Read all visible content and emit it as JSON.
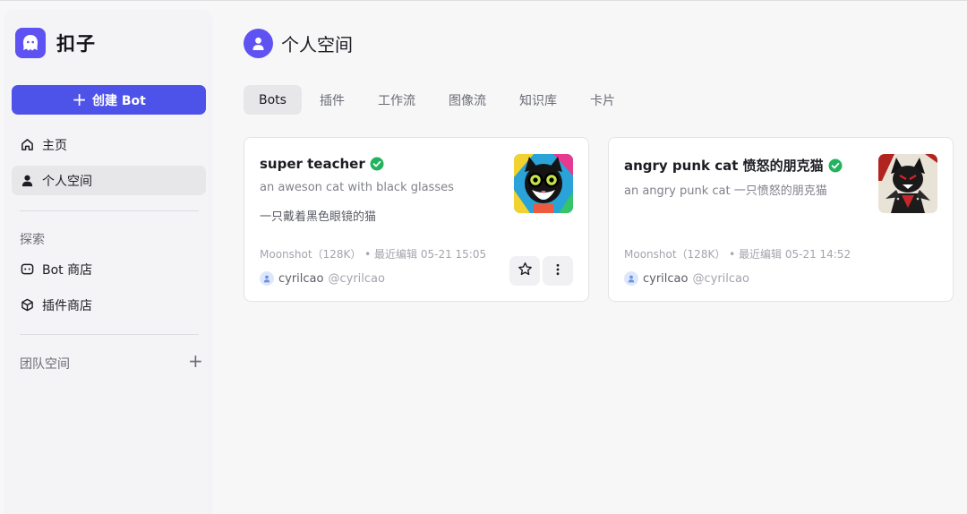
{
  "app": {
    "name": "扣子"
  },
  "sidebar": {
    "create_label": "创建 Bot",
    "nav": [
      {
        "label": "主页",
        "icon": "home-icon"
      },
      {
        "label": "个人空间",
        "icon": "user-icon",
        "active": true
      }
    ],
    "explore_label": "探索",
    "explore": [
      {
        "label": "Bot 商店",
        "icon": "bot-store-icon"
      },
      {
        "label": "插件商店",
        "icon": "cube-icon"
      }
    ],
    "team_label": "团队空间"
  },
  "header": {
    "title": "个人空间"
  },
  "tabs": [
    {
      "label": "Bots",
      "active": true
    },
    {
      "label": "插件"
    },
    {
      "label": "工作流"
    },
    {
      "label": "图像流"
    },
    {
      "label": "知识库"
    },
    {
      "label": "卡片"
    }
  ],
  "bots": [
    {
      "name": "super teacher",
      "desc": "an aweson cat with black glasses",
      "desc2": "一只戴着黑色眼镜的猫",
      "meta": "Moonshot（128K） • 最近编辑 05-21 15:05",
      "owner": "cyrilcao",
      "handle": "@cyrilcao"
    },
    {
      "name": "angry punk cat 愤怒的朋克猫",
      "desc": "an angry punk cat 一只愤怒的朋克猫",
      "desc2": "",
      "meta": "Moonshot（128K） • 最近编辑 05-21 14:52",
      "owner": "cyrilcao",
      "handle": "@cyrilcao"
    }
  ],
  "colors": {
    "accent": "#4d53e8",
    "brand": "#5e52f2",
    "verified": "#22b35e"
  }
}
